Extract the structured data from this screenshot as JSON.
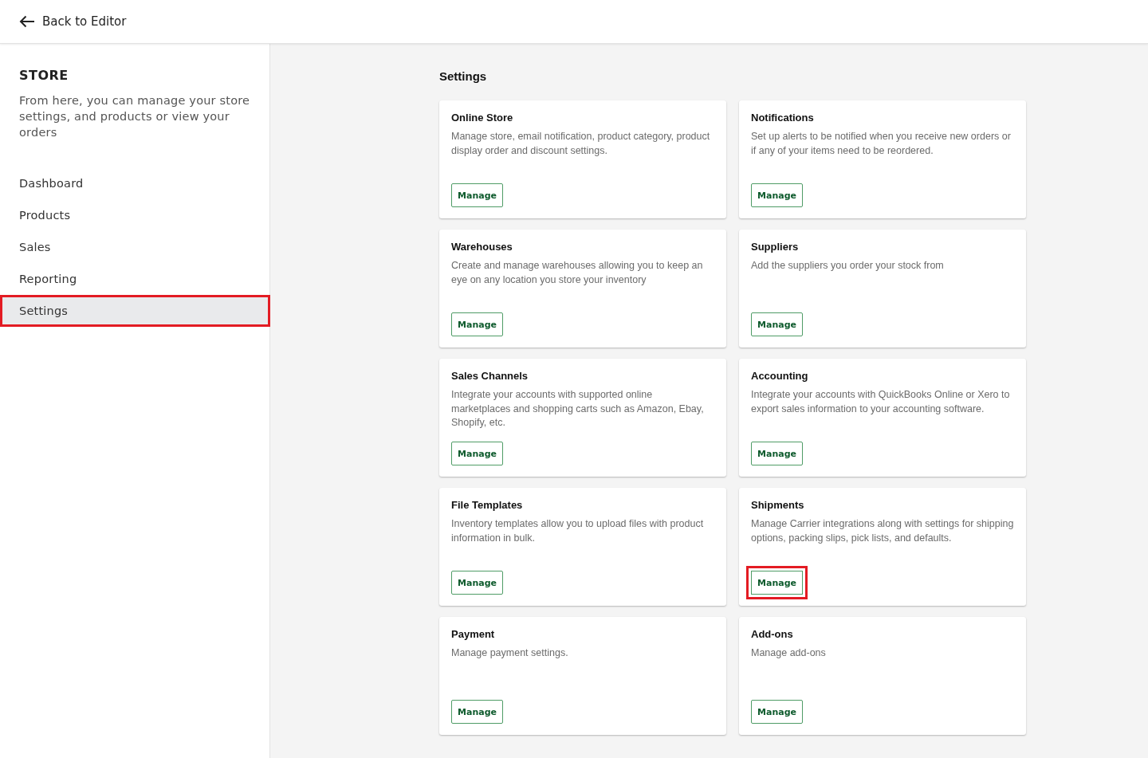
{
  "header": {
    "back_label": "Back to Editor"
  },
  "sidebar": {
    "title": "STORE",
    "description": "From here, you can manage your store settings, and products or view your orders",
    "items": [
      {
        "label": "Dashboard",
        "selected": false,
        "highlighted": false
      },
      {
        "label": "Products",
        "selected": false,
        "highlighted": false
      },
      {
        "label": "Sales",
        "selected": false,
        "highlighted": false
      },
      {
        "label": "Reporting",
        "selected": false,
        "highlighted": false
      },
      {
        "label": "Settings",
        "selected": true,
        "highlighted": true
      }
    ]
  },
  "main": {
    "title": "Settings",
    "cards": [
      {
        "title": "Online Store",
        "description": "Manage store, email notification, product category, product display order and discount settings.",
        "button": "Manage",
        "highlighted": false
      },
      {
        "title": "Notifications",
        "description": "Set up alerts to be notified when you receive new orders or if any of your items need to be reordered.",
        "button": "Manage",
        "highlighted": false
      },
      {
        "title": "Warehouses",
        "description": "Create and manage warehouses allowing you to keep an eye on any location you store your inventory",
        "button": "Manage",
        "highlighted": false
      },
      {
        "title": "Suppliers",
        "description": "Add the suppliers you order your stock from",
        "button": "Manage",
        "highlighted": false
      },
      {
        "title": "Sales Channels",
        "description": "Integrate your accounts with supported online marketplaces and shopping carts such as Amazon, Ebay, Shopify, etc.",
        "button": "Manage",
        "highlighted": false
      },
      {
        "title": "Accounting",
        "description": "Integrate your accounts with QuickBooks Online or Xero to export sales information to your accounting software.",
        "button": "Manage",
        "highlighted": false
      },
      {
        "title": "File Templates",
        "description": "Inventory templates allow you to upload files with product information in bulk.",
        "button": "Manage",
        "highlighted": false
      },
      {
        "title": "Shipments",
        "description": "Manage Carrier integrations along with settings for shipping options, packing slips, pick lists, and defaults.",
        "button": "Manage",
        "highlighted": true
      },
      {
        "title": "Payment",
        "description": "Manage payment settings.",
        "button": "Manage",
        "highlighted": false
      },
      {
        "title": "Add-ons",
        "description": "Manage add-ons",
        "button": "Manage",
        "highlighted": false
      }
    ]
  }
}
